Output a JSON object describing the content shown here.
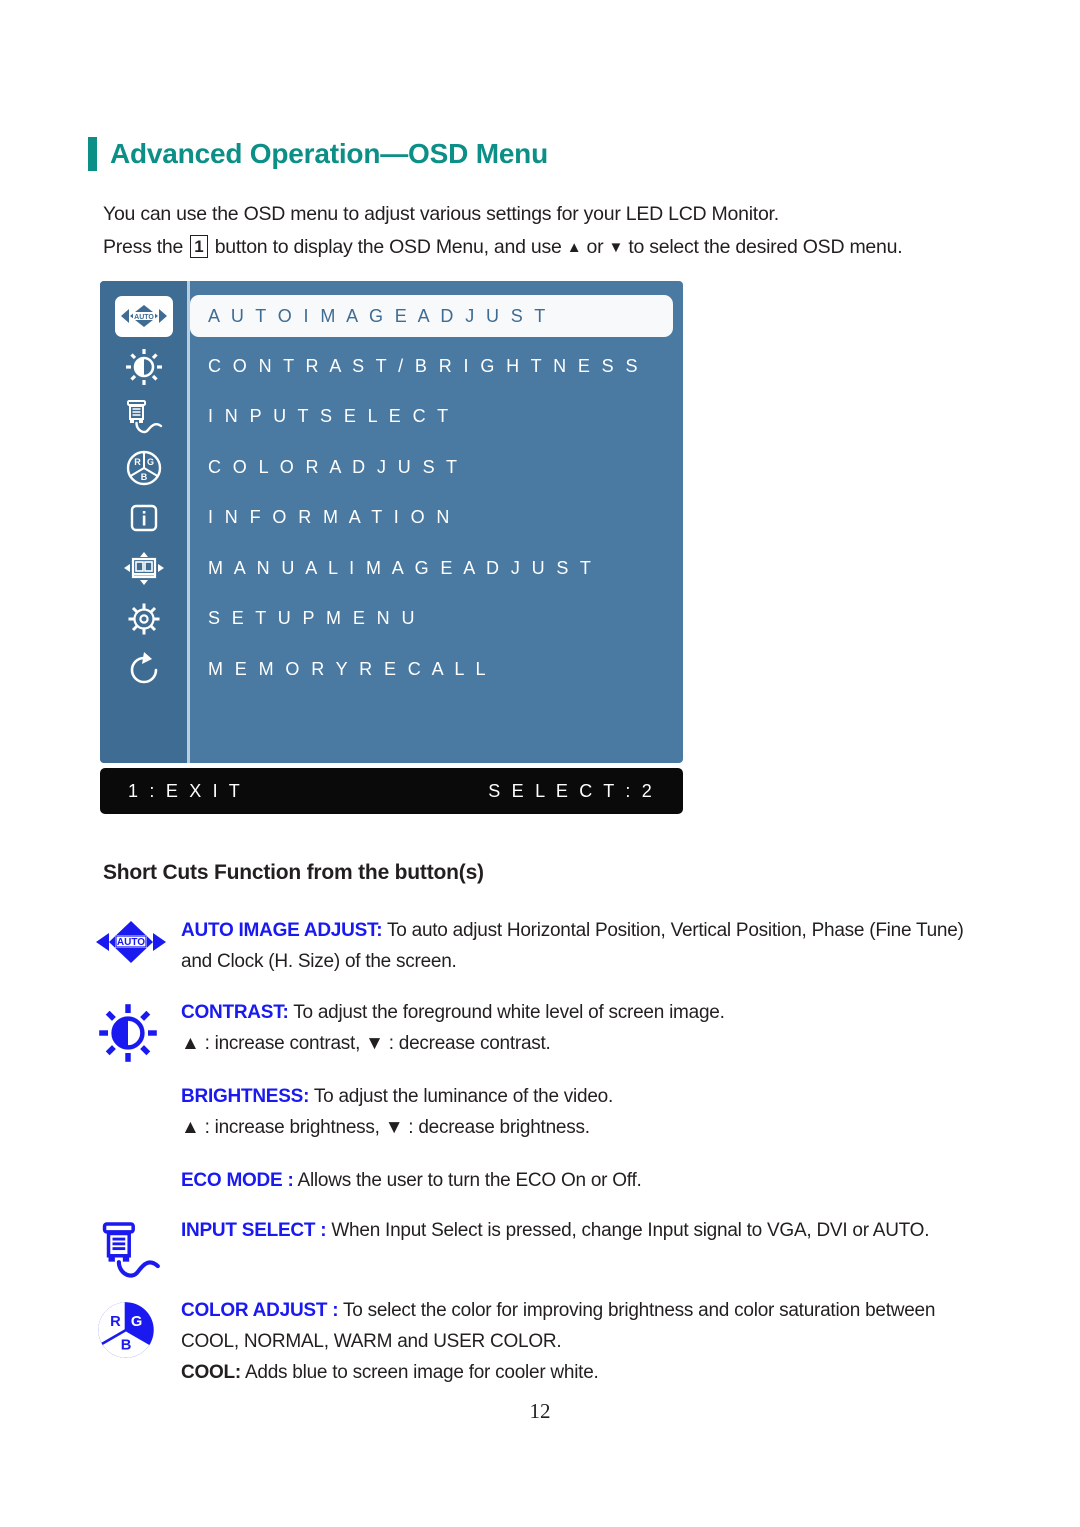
{
  "heading": {
    "title": "Advanced Operation—OSD Menu"
  },
  "intro": {
    "line1": "You can use the OSD menu to adjust various settings for your LED LCD Monitor.",
    "line2_a": "Press the",
    "key": "1",
    "line2_b": "button to display the OSD Menu, and use",
    "up": "▲",
    "or": "or",
    "down": "▼",
    "line2_c": "to select the desired OSD menu."
  },
  "osd": {
    "items": [
      {
        "label": "A U T O   I M A G E   A D J U S T",
        "icon": "auto-image-adjust-icon",
        "selected": true
      },
      {
        "label": "C O N T R A S T / B R I G H T N E S S",
        "icon": "brightness-sun-icon",
        "selected": false
      },
      {
        "label": "I N P U T   S E L E C T",
        "icon": "input-connector-icon",
        "selected": false
      },
      {
        "label": "C O L O R   A D J U S T",
        "icon": "rgb-wheel-icon",
        "selected": false
      },
      {
        "label": "I N F O R M A T I O N",
        "icon": "information-icon",
        "selected": false
      },
      {
        "label": "M A N U A L   I M A G E   A D J U S T",
        "icon": "manual-image-adjust-icon",
        "selected": false
      },
      {
        "label": "S E T U P   M E N U",
        "icon": "gear-icon",
        "selected": false
      },
      {
        "label": "M E M O R Y   R E C A L L",
        "icon": "memory-recall-icon",
        "selected": false
      }
    ],
    "footer": {
      "left": "1 : E X I T",
      "right": "S E L E C T : 2"
    },
    "colors": {
      "panel": "#4a7aa2",
      "sidebar": "#3f6c93",
      "footer": "#0a0a0a",
      "selected_bg": "#f7f9fb"
    }
  },
  "subheading": {
    "text": "Short Cuts Function from the button(s)"
  },
  "shortcuts": {
    "auto": {
      "label": "AUTO IMAGE ADJUST:",
      "body": " To auto adjust Horizontal Position, Vertical Position, Phase (Fine Tune) and Clock (H. Size) of the screen."
    },
    "contrast": {
      "label": "CONTRAST:",
      "body": " To adjust the foreground white level of screen image.",
      "line2": "▲ : increase contrast, ▼ : decrease contrast."
    },
    "brightness": {
      "label": "BRIGHTNESS:",
      "body": " To adjust the luminance of the video.",
      "line2": "▲ : increase brightness, ▼ : decrease brightness."
    },
    "eco": {
      "label": "ECO MODE :",
      "body": " Allows the user to turn the ECO On or Off."
    },
    "input": {
      "label": "INPUT SELECT :",
      "body": " When Input Select is pressed, change Input signal to VGA, DVI or AUTO."
    },
    "color": {
      "label": "COLOR ADJUST :",
      "body": " To select the color for improving brightness and color saturation between COOL, NORMAL, WARM and USER COLOR.",
      "cool_label": "COOL:",
      "cool_body": " Adds blue to screen image for cooler white."
    },
    "accent_color": "#1a1af0"
  },
  "footer": {
    "page_number": "12"
  }
}
